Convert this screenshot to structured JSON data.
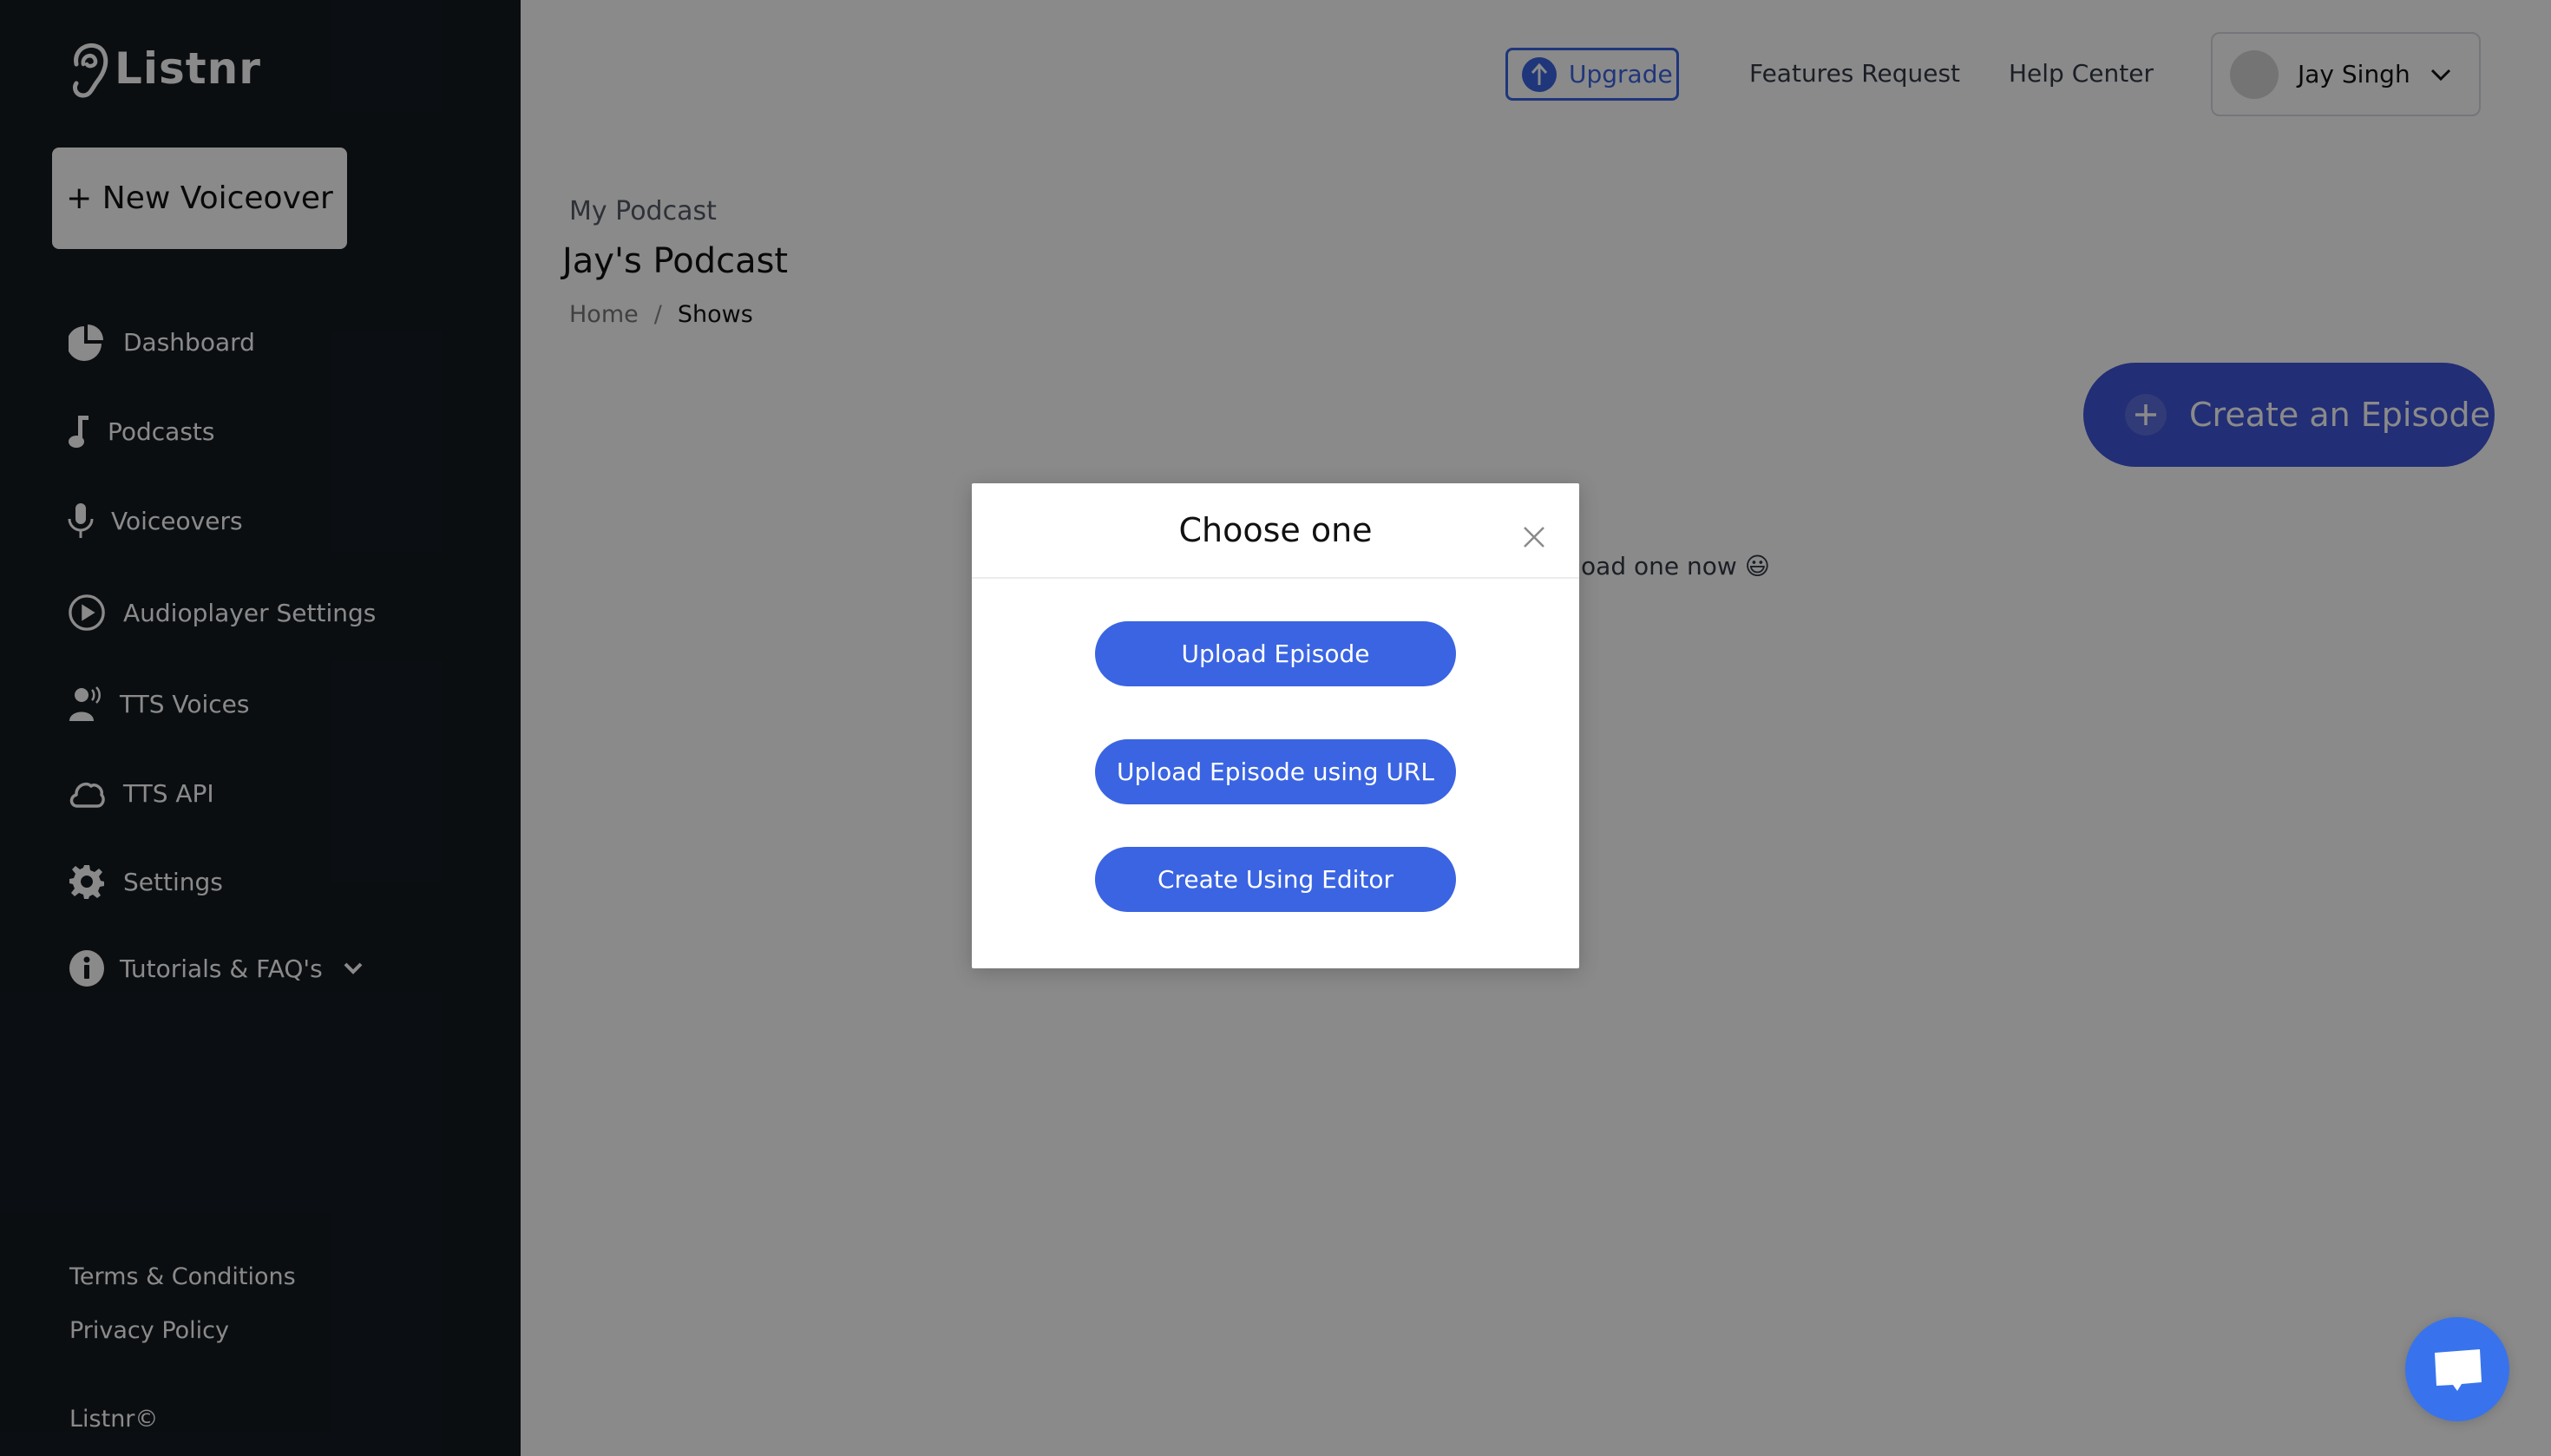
{
  "app": {
    "brand": "Listnr"
  },
  "sidebar": {
    "new_button": "+ New Voiceover",
    "items": [
      {
        "label": "Dashboard",
        "icon": "pie-chart-icon"
      },
      {
        "label": "Podcasts",
        "icon": "music-note-icon"
      },
      {
        "label": "Voiceovers",
        "icon": "microphone-icon"
      },
      {
        "label": "Audioplayer Settings",
        "icon": "play-circle-icon"
      },
      {
        "label": "TTS Voices",
        "icon": "speaking-person-icon"
      },
      {
        "label": "TTS API",
        "icon": "cloud-icon"
      },
      {
        "label": "Settings",
        "icon": "gear-icon"
      },
      {
        "label": "Tutorials & FAQ's",
        "icon": "info-icon"
      }
    ],
    "footer_links": [
      "Terms & Conditions",
      "Privacy Policy"
    ],
    "copyright": "Listnr©"
  },
  "topbar": {
    "upgrade": "Upgrade",
    "features_request": "Features Request",
    "help_center": "Help Center",
    "user_name": "Jay Singh"
  },
  "main": {
    "kicker": "My Podcast",
    "title": "Jay's Podcast",
    "breadcrumb": {
      "home": "Home",
      "separator": "/",
      "current": "Shows"
    },
    "create_button": "Create an Episode",
    "empty_message": "Upload one now 😃"
  },
  "modal": {
    "title": "Choose one",
    "options": [
      "Upload Episode",
      "Upload Episode using URL",
      "Create Using Editor"
    ]
  },
  "colors": {
    "sidebar_bg": "#151a21",
    "primary_blue": "#3a64e2",
    "create_button_blue": "#3f55d8",
    "chat_blue": "#3873ed"
  }
}
